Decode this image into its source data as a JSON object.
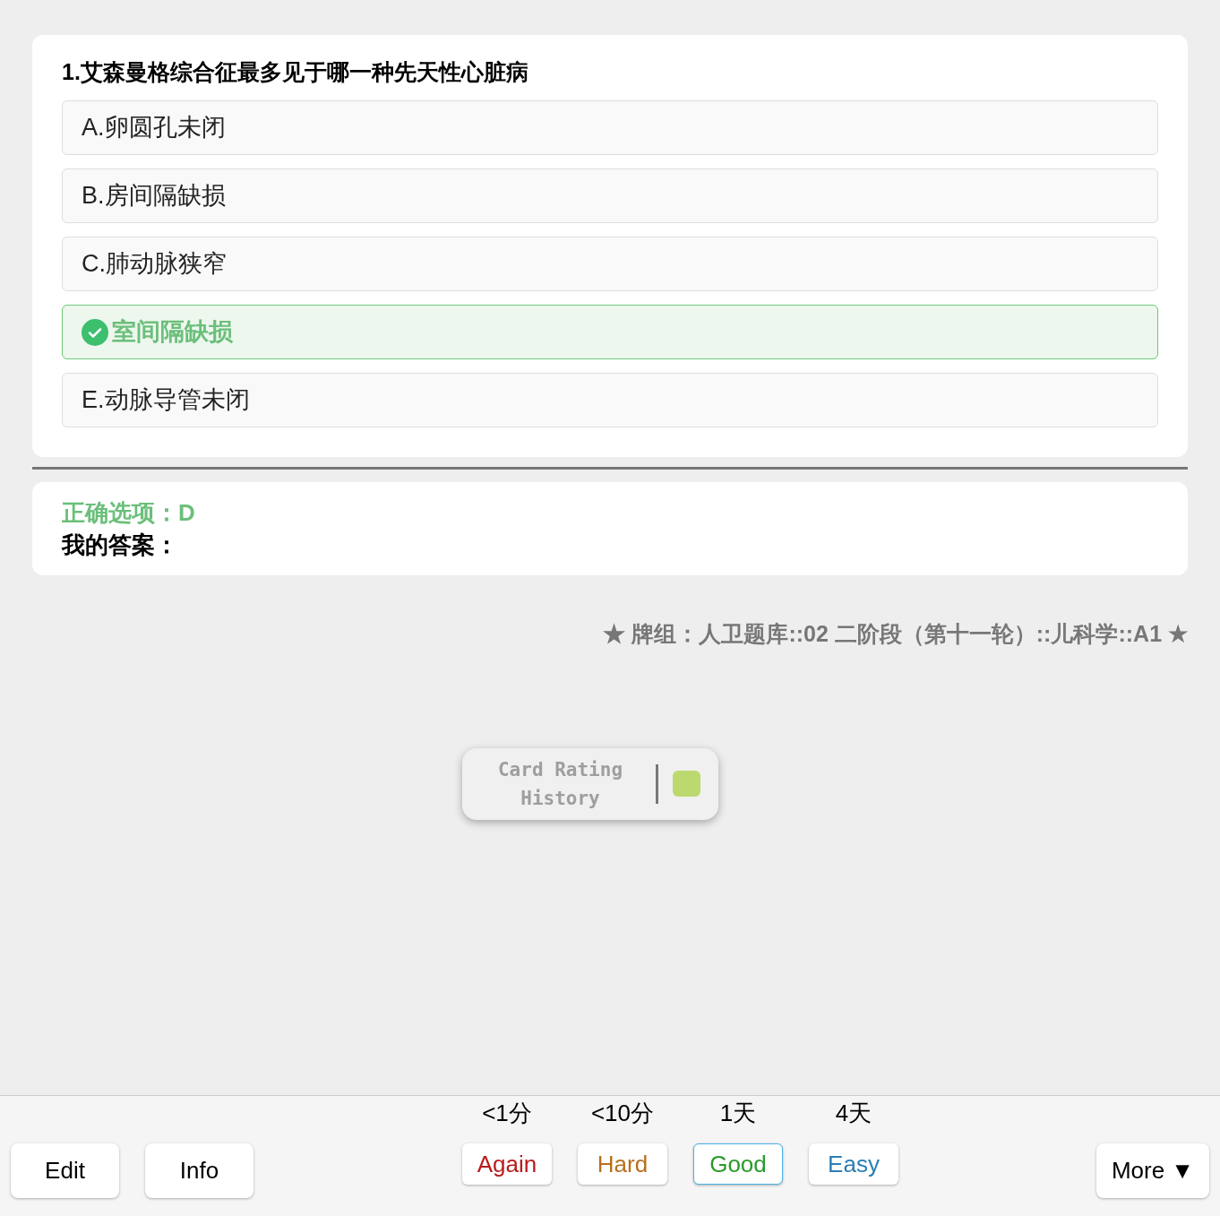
{
  "question": {
    "title": "1.艾森曼格综合征最多见于哪一种先天性心脏病",
    "options": [
      {
        "label": "A.",
        "text": "卵圆孔未闭",
        "correct": false
      },
      {
        "label": "B.",
        "text": "房间隔缺损",
        "correct": false
      },
      {
        "label": "C.",
        "text": "肺动脉狭窄",
        "correct": false
      },
      {
        "text": "室间隔缺损",
        "correct": true
      },
      {
        "label": "E.",
        "text": "动脉导管未闭",
        "correct": false
      }
    ]
  },
  "answer": {
    "correct_line": "正确选项：D",
    "my_answer_line": "我的答案："
  },
  "deck": "★ 牌组：人卫题库::02 二阶段（第十一轮）::儿科学::A1 ★",
  "rating_history": {
    "label": "Card Rating History",
    "ratings": [
      {
        "color": "#bbd96f"
      }
    ]
  },
  "bottom_bar": {
    "left_buttons": [
      "Edit",
      "Info"
    ],
    "answers": [
      {
        "interval": "<1分",
        "label": "Again",
        "kind": "again",
        "selected": false
      },
      {
        "interval": "<10分",
        "label": "Hard",
        "kind": "hard",
        "selected": false
      },
      {
        "interval": "1天",
        "label": "Good",
        "kind": "good",
        "selected": true
      },
      {
        "interval": "4天",
        "label": "Easy",
        "kind": "easy",
        "selected": false
      }
    ],
    "more": "More ▼"
  }
}
